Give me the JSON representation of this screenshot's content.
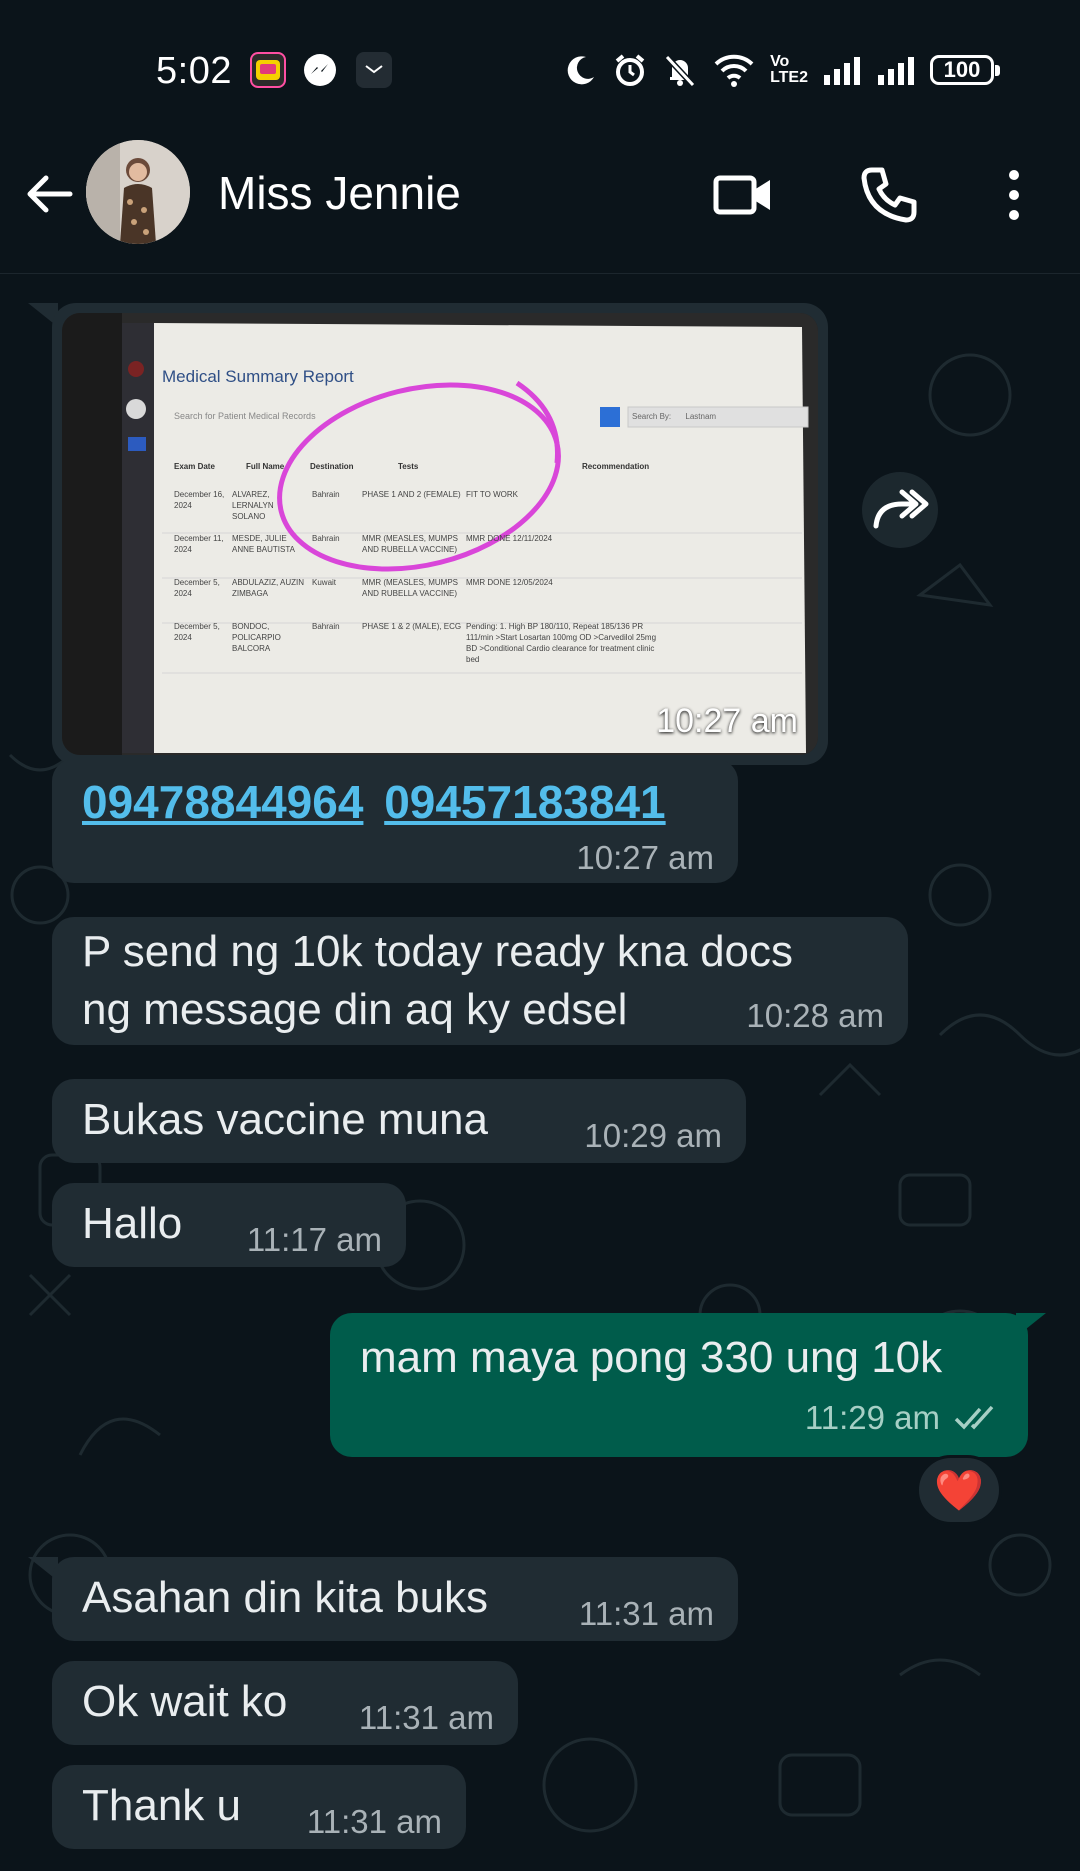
{
  "status_bar": {
    "time": "5:02",
    "battery": "100",
    "network_label": "LTE2",
    "volte_label": "Vo"
  },
  "header": {
    "contact_name": "Miss Jennie"
  },
  "messages": [
    {
      "type": "image",
      "direction": "in",
      "time": "10:27 am",
      "image": {
        "title": "Medical Summary Report",
        "search_placeholder": "Search for Patient Medical Records",
        "search_by": "Search By:",
        "search_by_value": "Lastnam",
        "columns": [
          "Exam Date",
          "Full Name",
          "Destination",
          "Tests",
          "Recommendation"
        ],
        "rows": [
          [
            "December 16, 2024",
            "ALVAREZ, LERNALYN SOLANO",
            "Bahrain",
            "PHASE 1 AND 2 (FEMALE)",
            "FIT TO WORK"
          ],
          [
            "December 11, 2024",
            "MESDE, JULIE ANNE BAUTISTA",
            "Bahrain",
            "MMR (MEASLES, MUMPS AND RUBELLA VACCINE)",
            "MMR DONE 12/11/2024"
          ],
          [
            "December 5, 2024",
            "ABDULAZIZ, AUZIN ZIMBAGA",
            "Kuwait",
            "MMR (MEASLES, MUMPS AND RUBELLA VACCINE)",
            "MMR DONE 12/05/2024"
          ],
          [
            "December 5, 2024",
            "BONDOC, POLICARPIO BALCORA",
            "Bahrain",
            "PHASE 1 & 2 (MALE), ECG",
            "Pending: 1. High BP 180/110, Repeat 185/136 PR 111/min >Start Losartan 100mg OD >Carvedilol 25mg BD >Conditional Cardio clearance for treatment clinic bed"
          ]
        ]
      }
    },
    {
      "type": "links",
      "direction": "in",
      "links": [
        "09478844964",
        "09457183841"
      ],
      "time": "10:27 am"
    },
    {
      "type": "text",
      "direction": "in",
      "lines": [
        "P send ng 10k  today ready  kna docs",
        "ng message  din aq ky edsel"
      ],
      "time": "10:28 am"
    },
    {
      "type": "text",
      "direction": "in",
      "text": "Bukas vaccine  muna",
      "time": "10:29 am"
    },
    {
      "type": "text",
      "direction": "in",
      "text": "Hallo",
      "time": "11:17 am"
    },
    {
      "type": "text",
      "direction": "out",
      "text": "mam maya pong 330 ung 10k",
      "time": "11:29 am",
      "status": "read",
      "reaction": "❤️"
    },
    {
      "type": "text",
      "direction": "in",
      "text": "Asahan din kita buks",
      "time": "11:31 am"
    },
    {
      "type": "text",
      "direction": "in",
      "text": "Ok wait ko",
      "time": "11:31 am"
    },
    {
      "type": "text",
      "direction": "in",
      "text": "Thank u",
      "time": "11:31 am"
    }
  ],
  "colors": {
    "background": "#0b141a",
    "bubble_in": "#202c33",
    "bubble_out": "#005c4b",
    "link": "#53bdeb",
    "read_ticks": "#a6cfc5"
  },
  "icons": [
    "back-arrow-icon",
    "video-call-icon",
    "voice-call-icon",
    "more-options-icon",
    "forward-icon",
    "double-check-icon",
    "heart-reaction"
  ]
}
